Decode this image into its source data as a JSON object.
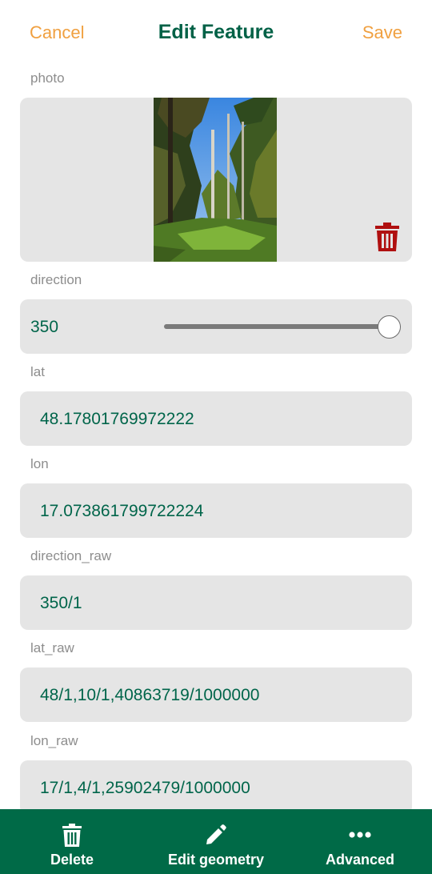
{
  "header": {
    "cancel_label": "Cancel",
    "title": "Edit Feature",
    "save_label": "Save"
  },
  "fields": {
    "photo": {
      "label": "photo"
    },
    "direction": {
      "label": "direction",
      "value": "350",
      "slider_fraction": 0.95
    },
    "lat": {
      "label": "lat",
      "value": "48.17801769972222"
    },
    "lon": {
      "label": "lon",
      "value": "17.073861799722224"
    },
    "direction_raw": {
      "label": "direction_raw",
      "value": "350/1"
    },
    "lat_raw": {
      "label": "lat_raw",
      "value": "48/1,10/1,40863719/1000000"
    },
    "lon_raw": {
      "label": "lon_raw",
      "value": "17/1,4/1,25902479/1000000"
    }
  },
  "toolbar": {
    "delete_label": "Delete",
    "edit_geometry_label": "Edit geometry",
    "advanced_label": "Advanced"
  },
  "icons": {
    "photo_trash": "trash-icon",
    "delete": "trash-icon",
    "edit_geometry": "pencil-icon",
    "advanced": "more-horizontal-icon"
  },
  "colors": {
    "accent_orange": "#f0a040",
    "brand_green": "#006146",
    "value_green": "#00654a",
    "toolbar_green": "#006a47",
    "danger_red": "#b01010",
    "field_bg": "#e5e5e5"
  }
}
